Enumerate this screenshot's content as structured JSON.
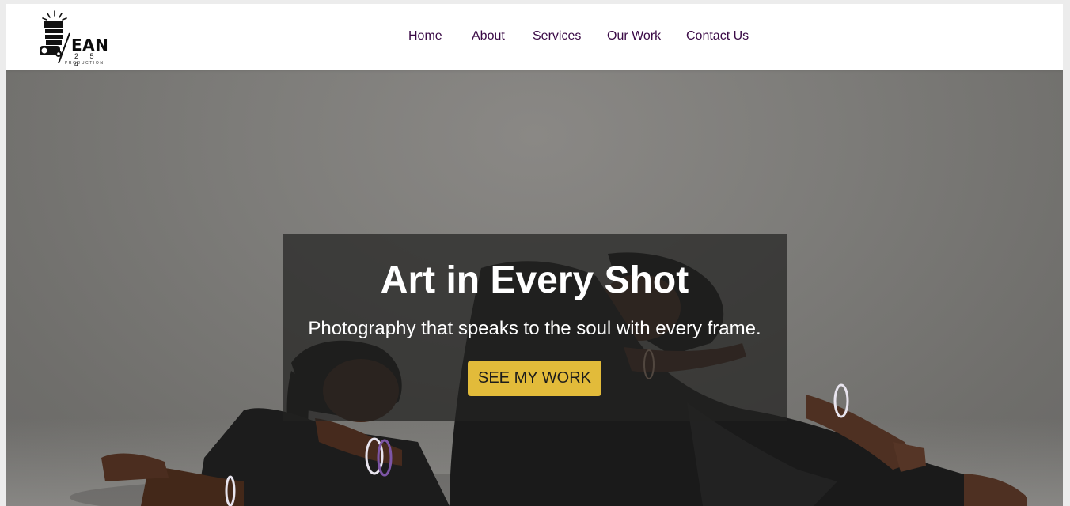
{
  "brand": {
    "logo_word": "EAN",
    "logo_number": "2 5 4",
    "logo_tagline": "PRODUCTION",
    "logo_icon": "camera-flash-icon"
  },
  "nav": {
    "items": [
      {
        "label": "Home"
      },
      {
        "label": "About"
      },
      {
        "label": "Services"
      },
      {
        "label": "Our Work"
      },
      {
        "label": "Contact Us"
      }
    ],
    "link_color": "#3a0a46"
  },
  "hero": {
    "title": "Art in Every Shot",
    "subtitle": "Photography that speaks to the soul with every frame.",
    "cta_label": "SEE MY WORK",
    "cta_color": "#e2bb3a",
    "background_image": "photo-two-women-lying-on-studio-floor"
  }
}
